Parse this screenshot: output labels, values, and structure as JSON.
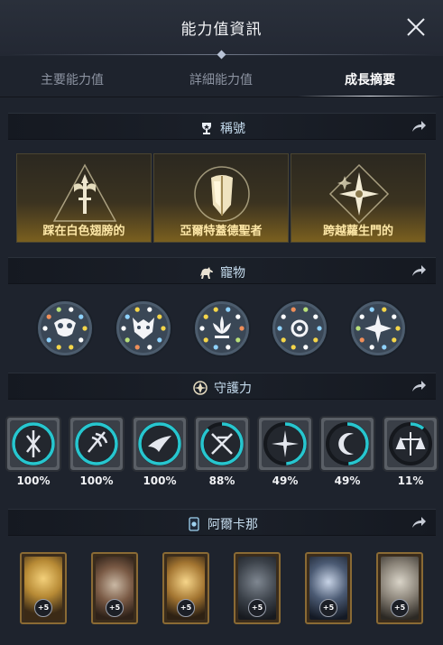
{
  "window": {
    "title": "能力值資訊"
  },
  "tabs": [
    {
      "label": "主要能力值",
      "active": false
    },
    {
      "label": "詳細能力值",
      "active": false
    },
    {
      "label": "成長摘要",
      "active": true
    }
  ],
  "titles_section": {
    "label": "稱號",
    "items": [
      {
        "name": "踩在白色翅膀的",
        "icon": "winged-sword-emblem-icon"
      },
      {
        "name": "亞爾特蓋德聖者",
        "icon": "shield-emblem-icon"
      },
      {
        "name": "跨越蘿生門的",
        "icon": "star-gate-emblem-icon"
      }
    ]
  },
  "pets_section": {
    "label": "寵物",
    "items": [
      {
        "icon": "owl-mask-icon"
      },
      {
        "icon": "wolf-mask-icon"
      },
      {
        "icon": "lotus-icon"
      },
      {
        "icon": "sun-ring-icon"
      },
      {
        "icon": "star-burst-icon"
      }
    ]
  },
  "guardian_section": {
    "label": "守護力",
    "items": [
      {
        "percent": "100%",
        "progress": 1.0,
        "icon": "sword-shield-icon"
      },
      {
        "percent": "100%",
        "progress": 1.0,
        "icon": "wing-blade-icon"
      },
      {
        "percent": "100%",
        "progress": 1.0,
        "icon": "flying-bird-icon"
      },
      {
        "percent": "88%",
        "progress": 0.88,
        "icon": "crossed-swords-icon"
      },
      {
        "percent": "49%",
        "progress": 0.49,
        "icon": "compass-star-icon"
      },
      {
        "percent": "49%",
        "progress": 0.49,
        "icon": "crescent-moon-icon"
      },
      {
        "percent": "11%",
        "progress": 0.11,
        "icon": "scales-icon"
      }
    ]
  },
  "arcana_section": {
    "label": "阿爾卡那",
    "cards": [
      {
        "level": "+5",
        "icon": "golden-chalice-card"
      },
      {
        "level": "+5",
        "icon": "hands-card"
      },
      {
        "level": "+5",
        "icon": "golden-hall-card"
      },
      {
        "level": "+5",
        "icon": "dark-throne-card"
      },
      {
        "level": "+5",
        "icon": "crystal-crown-card"
      },
      {
        "level": "+5",
        "icon": "stone-gate-card"
      }
    ]
  },
  "colors": {
    "background": "#1e232d",
    "section_label": "#c5dcee",
    "title_text": "#fde7a6",
    "guardian_ring": "#27c6cf"
  }
}
